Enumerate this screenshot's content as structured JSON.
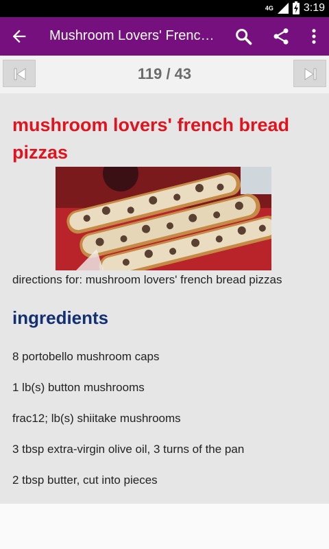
{
  "status": {
    "network": "4G",
    "time": "3:19"
  },
  "appbar": {
    "title": "Mushroom Lovers' French…"
  },
  "pager": {
    "count": "119 / 43"
  },
  "recipe": {
    "title": "mushroom lovers' french bread pizzas",
    "directions": "directions for: mushroom lovers' french bread pizzas",
    "ingredients_heading": "ingredients",
    "ingredients": [
      "8 portobello mushroom caps",
      "1 lb(s) button mushrooms",
      "frac12; lb(s) shiitake mushrooms",
      "3 tbsp extra-virgin olive oil, 3 turns of the pan",
      "2 tbsp butter, cut into pieces"
    ]
  },
  "icons": {
    "back": "arrow-left-icon",
    "search": "search-icon",
    "share": "share-icon",
    "overflow": "more-vert-icon",
    "first": "skip-previous-icon",
    "last": "skip-next-icon"
  },
  "colors": {
    "appbar": "#77107f",
    "title": "#e0141e",
    "heading": "#123072"
  }
}
